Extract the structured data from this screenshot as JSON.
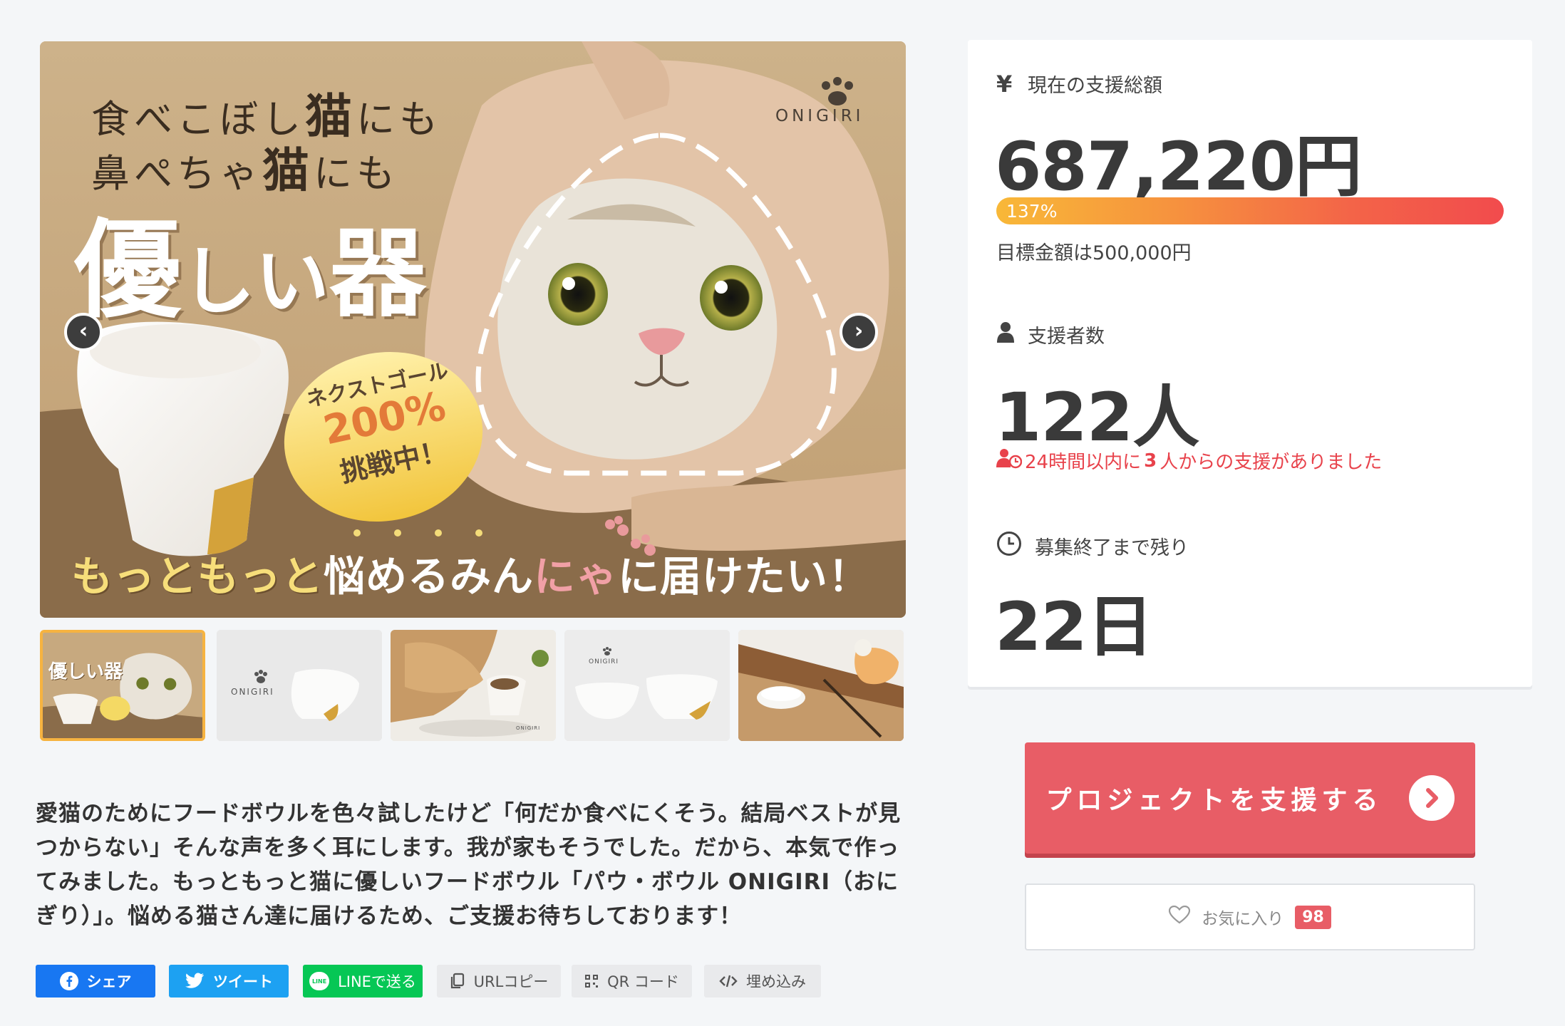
{
  "gallery": {
    "main": {
      "headline_line1_a": "食べこぼし",
      "headline_line1_b": "猫",
      "headline_line1_c": "にも",
      "headline_line2_a": "鼻ぺちゃ",
      "headline_line2_b": "猫",
      "headline_line2_c": "にも",
      "headline_big_a": "優",
      "headline_big_b": "しい",
      "headline_big_c": "器",
      "brand": "ONIGIRI",
      "badge_line1": "ネクストゴール",
      "badge_line2": "200%",
      "badge_line3": "挑戦中！",
      "bottom_text_a": "もっともっと",
      "bottom_text_b": "悩めるみん",
      "bottom_text_c": "にゃ",
      "bottom_text_d": "に届けたい！"
    },
    "prev_arrow": "‹",
    "next_arrow": "›",
    "thumbnails": [
      {
        "label": "優しい器",
        "brand": ""
      },
      {
        "label": "",
        "brand": "ONIGIRI"
      },
      {
        "label": "",
        "brand": "ONIGIRI"
      },
      {
        "label": "",
        "brand": "ONIGIRI"
      },
      {
        "label": "",
        "brand": ""
      }
    ]
  },
  "description": "愛猫のためにフードボウルを色々試したけど「何だか食べにくそう。結局ベストが見つからない」そんな声を多く耳にします。我が家もそうでした。だから、本気で作ってみました。もっともっと猫に優しいフードボウル「パウ・ボウル ONIGIRI（おにぎり）」。悩める猫さん達に届けるため、ご支援お待ちしております！",
  "share": {
    "facebook": "シェア",
    "twitter": "ツイート",
    "line": "LINEで送る",
    "url_copy": "URLコピー",
    "qr": "QR コード",
    "embed": "埋め込み",
    "line_icon_text": "LINE"
  },
  "stats": {
    "total_label": "現在の支援総額",
    "total_icon": "¥",
    "total_amount": "687,220円",
    "progress_text": "137%",
    "progress_value": 1.37,
    "goal_text": "目標金額は500,000円",
    "supporters_label": "支援者数",
    "supporters_count": "122人",
    "recent_a": "24時間以内に",
    "recent_b": "3",
    "recent_c": "人からの支援がありました",
    "remaining_label": "募集終了まで残り",
    "remaining_days": "22日"
  },
  "actions": {
    "support_label": "プロジェクトを支援する",
    "favorite_label": "お気に入り",
    "favorite_count": "98"
  },
  "colors": {
    "accent": "#e85d66",
    "facebook": "#1877f2",
    "twitter": "#1da1f2",
    "line": "#06c755",
    "thumb_active": "#f6b340"
  }
}
